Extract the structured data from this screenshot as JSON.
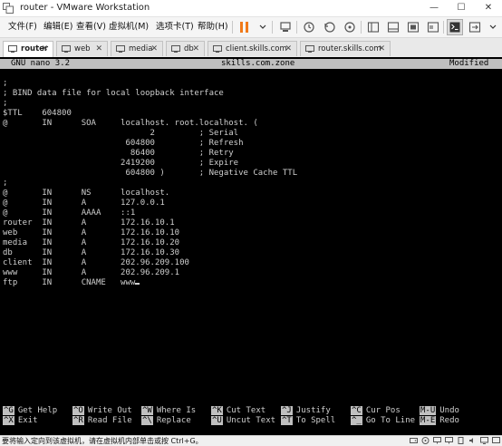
{
  "window": {
    "title": "router - VMware Workstation",
    "controls": [
      "—",
      "☐",
      "✕"
    ]
  },
  "menu": {
    "items": [
      "文件(F)",
      "编辑(E)",
      "查看(V)",
      "虚拟机(M)",
      "选项卡(T)",
      "帮助(H)"
    ]
  },
  "tabs": [
    {
      "label": "router",
      "active": true
    },
    {
      "label": "web",
      "active": false
    },
    {
      "label": "media",
      "active": false
    },
    {
      "label": "db",
      "active": false
    },
    {
      "label": "client.skills.com",
      "active": false
    },
    {
      "label": "router.skills.com",
      "active": false
    }
  ],
  "nano": {
    "version": "GNU nano 3.2",
    "filename": "skills.com.zone",
    "status": "Modified",
    "lines": [
      ";",
      "; BIND data file for local loopback interface",
      ";",
      "$TTL    604800",
      "@       IN      SOA     localhost. root.localhost. (",
      "                              2         ; Serial",
      "                         604800         ; Refresh",
      "                          86400         ; Retry",
      "                        2419200         ; Expire",
      "                         604800 )       ; Negative Cache TTL",
      ";",
      "@       IN      NS      localhost.",
      "@       IN      A       127.0.0.1",
      "@       IN      AAAA    ::1",
      "router  IN      A       172.16.10.1",
      "web     IN      A       172.16.10.10",
      "media   IN      A       172.16.10.20",
      "db      IN      A       172.16.10.30",
      "client  IN      A       202.96.209.100",
      "www     IN      A       202.96.209.1",
      "ftp     IN      CNAME   www"
    ],
    "shortcuts_row1": [
      {
        "key": "^G",
        "label": "Get Help"
      },
      {
        "key": "^O",
        "label": "Write Out"
      },
      {
        "key": "^W",
        "label": "Where Is"
      },
      {
        "key": "^K",
        "label": "Cut Text"
      },
      {
        "key": "^J",
        "label": "Justify"
      },
      {
        "key": "^C",
        "label": "Cur Pos"
      },
      {
        "key": "M-U",
        "label": "Undo"
      }
    ],
    "shortcuts_row2": [
      {
        "key": "^X",
        "label": "Exit"
      },
      {
        "key": "^R",
        "label": "Read File"
      },
      {
        "key": "^\\",
        "label": "Replace"
      },
      {
        "key": "^U",
        "label": "Uncut Text"
      },
      {
        "key": "^T",
        "label": "To Spell"
      },
      {
        "key": "^_",
        "label": "Go To Line"
      },
      {
        "key": "M-E",
        "label": "Redo"
      }
    ]
  },
  "statusbar": {
    "hint": "要将输入定向到该虚拟机，请在虚拟机内部单击或按 Ctrl+G。"
  }
}
